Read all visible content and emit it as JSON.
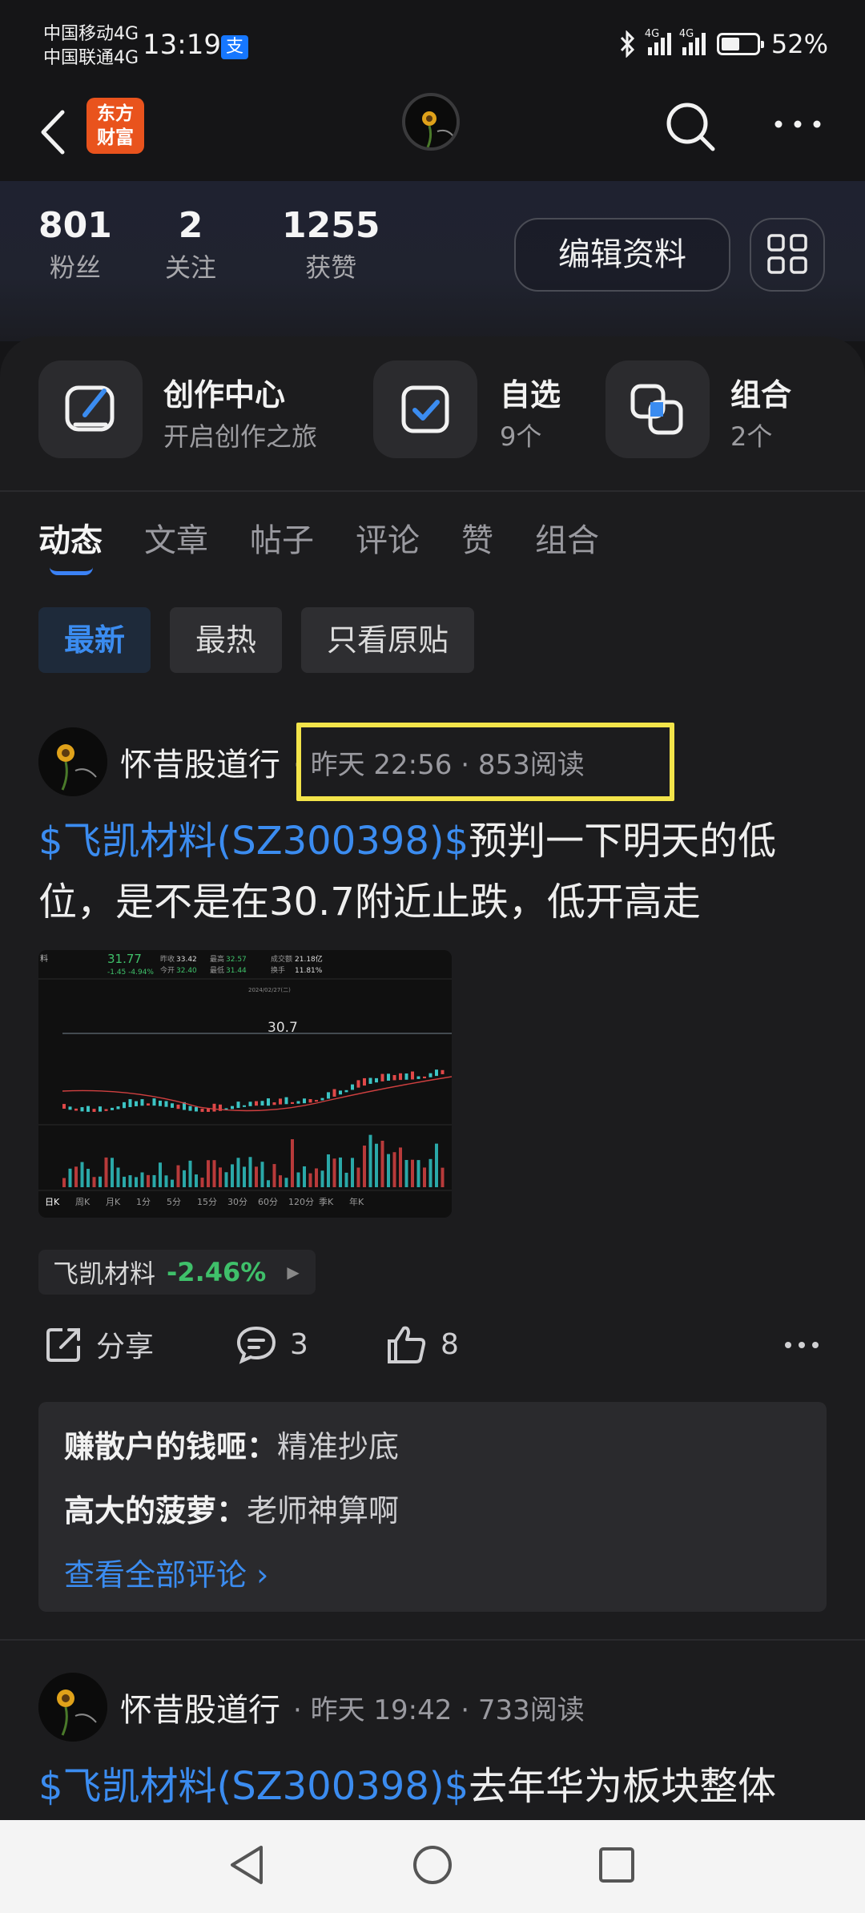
{
  "status_bar": {
    "carrier1": "中国移动4G",
    "carrier2": "中国联通4G",
    "time": "13:19",
    "pay_icon": "支",
    "signal1_label": "4G",
    "signal2_label": "4G",
    "battery": "52%",
    "battery_level": 0.52
  },
  "nav": {
    "logo_line1": "东方",
    "logo_line2": "财富"
  },
  "profile": {
    "stats": [
      {
        "value": "801",
        "label": "粉丝"
      },
      {
        "value": "2",
        "label": "关注"
      },
      {
        "value": "1255",
        "label": "获赞"
      }
    ],
    "edit_label": "编辑资料"
  },
  "quick_actions": [
    {
      "title": "创作中心",
      "sub": "开启创作之旅",
      "icon": "edit-icon"
    },
    {
      "title": "自选",
      "sub": "9个",
      "icon": "checkbox-icon"
    },
    {
      "title": "组合",
      "sub": "2个",
      "icon": "combo-icon"
    }
  ],
  "tabs": [
    "动态",
    "文章",
    "帖子",
    "评论",
    "赞",
    "组合"
  ],
  "filters": [
    "最新",
    "最热",
    "只看原贴"
  ],
  "posts": [
    {
      "author": "怀昔股道行",
      "meta": "· 昨天 22:56 · 853阅读",
      "stock": "$飞凯材料(SZ300398)$",
      "text_line1": "预判一下明天的低",
      "text_line2": "位，是不是在30.7附近止跌，低开高走",
      "pill_name": "飞凯材料",
      "pill_change": "-2.46%",
      "share_label": "分享",
      "comment_count": "3",
      "like_count": "8",
      "comments": [
        {
          "user": "赚散户的钱咂：",
          "text": "精准抄底"
        },
        {
          "user": "高大的菠萝：",
          "text": "老师神算啊"
        }
      ],
      "view_all": "查看全部评论 ›"
    },
    {
      "author": "怀昔股道行",
      "meta": "· 昨天 19:42 · 733阅读",
      "stock": "$飞凯材料(SZ300398)$",
      "text_line1": "去年华为板块整体"
    }
  ],
  "thumbnail": {
    "price": "31.77",
    "change": "-1.45 -4.94%",
    "prev_label": "昨收",
    "prev": "33.42",
    "open_label": "今开",
    "open": "32.40",
    "high_label": "最高",
    "high": "32.57",
    "low_label": "最低",
    "low": "31.44",
    "amount_label": "成交额",
    "amount": "21.18亿",
    "turnover_label": "换手",
    "turnover": "11.81%",
    "level_label": "30.7",
    "left_tag": "料",
    "date": "2024/02/27(二)",
    "periods": [
      "日K",
      "周K",
      "月K",
      "1分",
      "5分",
      "15分",
      "30分",
      "60分",
      "120分",
      "季K",
      "年K"
    ]
  },
  "colors": {
    "accent_blue": "#3b8cf0",
    "down_green": "#3fc06a",
    "highlight_yellow": "#f3e44a",
    "logo_orange": "#e9531d"
  }
}
